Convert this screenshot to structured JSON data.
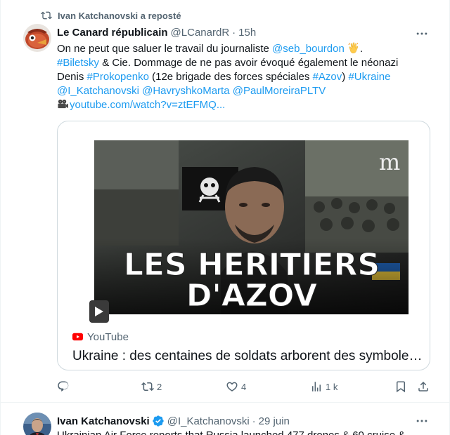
{
  "tweets": [
    {
      "repost_label": "Ivan Katchanovski a reposté",
      "author_name": "Le Canard républicain",
      "author_handle": "@LCanardR",
      "separator": "·",
      "time": "15h",
      "text_parts": {
        "p1": "On ne peut que saluer le travail du journaliste ",
        "mention_seb": "@seb_bourdon",
        "p2": ".",
        "tag_biletsky": "#Biletsky",
        "p3": " & Cie. Dommage de ne pas avoir évoqué également le néonazi Denis ",
        "tag_prokopenko": "#Prokopenko",
        "p4": " (12e brigade des forces spéciales ",
        "tag_azov": "#Azov",
        "p5": ") ",
        "tag_ukraine": "#Ukraine",
        "mention_katch": "@I_Katchanovski",
        "mention_havr": "@HavryshkoMarta",
        "mention_paul": "@PaulMoreiraPLTV",
        "link_youtube": "youtube.com/watch?v=ztEFMQ..."
      },
      "card": {
        "thumbnail_title_line1": "LES HERITIERS",
        "thumbnail_title_line2": "D'AZOV",
        "thumbnail_logo": "m",
        "source": "YouTube",
        "title": "Ukraine : des centaines de soldats arborent des symboles néonazis"
      },
      "actions": {
        "reply_count": "",
        "repost_count": "2",
        "like_count": "4",
        "views_count": "1 k"
      },
      "icons": [
        "repost-icon",
        "more-icon",
        "clap-emoji-icon",
        "film-camera-emoji-icon",
        "play-icon",
        "youtube-icon",
        "reply-icon",
        "like-icon",
        "views-icon",
        "bookmark-icon",
        "share-icon"
      ]
    },
    {
      "author_name": "Ivan Katchanovski",
      "author_handle": "@I_Katchanovski",
      "separator": "·",
      "time": "29 juin",
      "text": "Ukrainian Air Force reports that Russia launched 477 drones & 60 cruise &"
    }
  ],
  "colors": {
    "text_primary": "#0f1419",
    "text_secondary": "#536471",
    "link": "#1d9bf0",
    "border": "#cfd9de",
    "verified": "#1d9bf0",
    "youtube_red": "#ff0000"
  }
}
